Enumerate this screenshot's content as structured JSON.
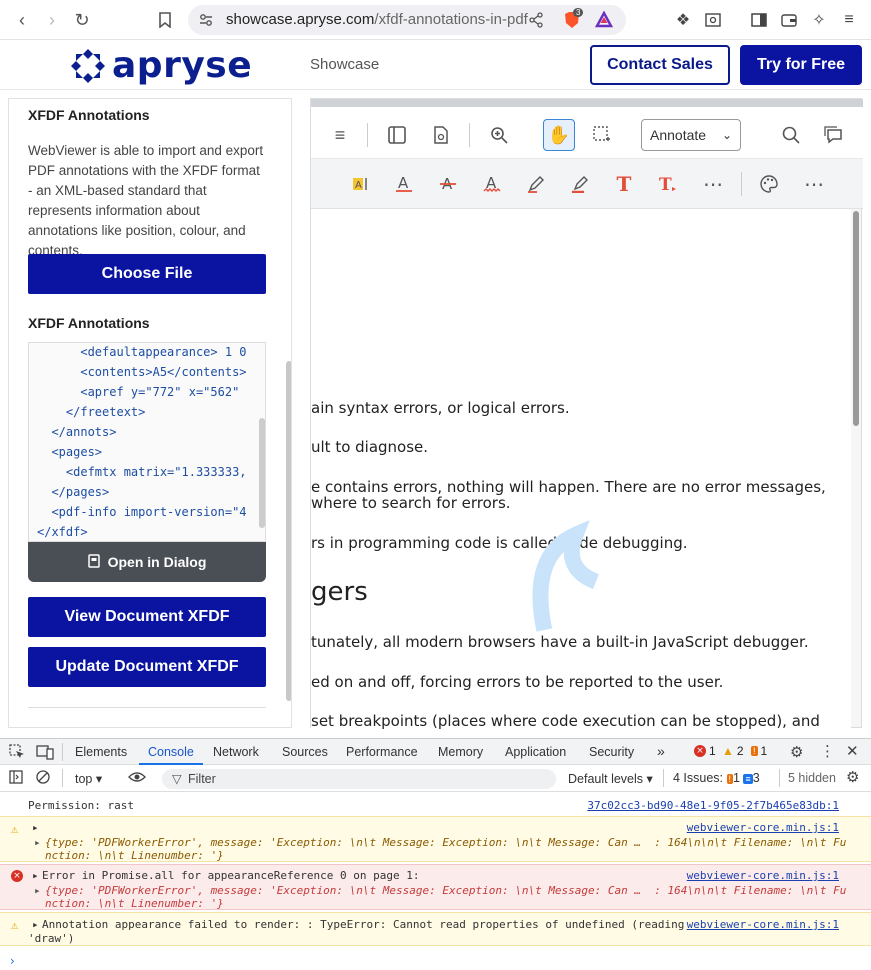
{
  "browser": {
    "url_host": "showcase.apryse.com",
    "url_path": "/xfdf-annotations-in-pdf",
    "brave_badge": "3"
  },
  "site": {
    "logo_text": "apryse",
    "nav_showcase": "Showcase",
    "contact_sales": "Contact Sales",
    "try_free": "Try for Free",
    "brand_color": "#0a14a0"
  },
  "left_panel": {
    "title": "XFDF Annotations",
    "description": "WebViewer is able to import and export PDF annotations with the XFDF format - an XML-based standard that represents information about annotations like position, colour, and contents.",
    "choose_file": "Choose File",
    "annotations_label": "XFDF Annotations",
    "code_lines": [
      "      <defaultappearance> 1 0",
      "      <contents>A5</contents>",
      "      <apref y=\"772\" x=\"562\"",
      "    </freetext>",
      "  </annots>",
      "  <pages>",
      "    <defmtx matrix=\"1.333333,",
      "  </pages>",
      "  <pdf-info import-version=\"4",
      "</xfdf>"
    ],
    "open_dialog": "Open in Dialog",
    "view_xfdf": "View Document XFDF",
    "update_xfdf": "Update Document XFDF"
  },
  "viewer": {
    "annotate_select": "Annotate",
    "page_lines": [
      "ain syntax errors, or logical errors.",
      "ult to diagnose.",
      "e contains errors, nothing will happen. There are no error messages,",
      " where to search for errors.",
      "rs in programming code is called code debugging.",
      "tunately, all modern browsers have a built-in JavaScript debugger.",
      "ed on and off, forcing errors to be reported to the user.",
      "set breakpoints (places where code execution can be stopped), and"
    ],
    "heading": "gers"
  },
  "devtools": {
    "tabs": [
      "Elements",
      "Console",
      "Network",
      "Sources",
      "Performance",
      "Memory",
      "Application",
      "Security"
    ],
    "active_tab": "Console",
    "err_count": "1",
    "warn_count": "2",
    "info_count": "1",
    "context": "top",
    "filter_placeholder": "Filter",
    "levels": "Default levels",
    "issues_label": "4 Issues:",
    "issues_a": "1",
    "issues_b": "3",
    "hidden": "5 hidden"
  },
  "console": {
    "line1_text": "Permission: rast",
    "line1_src": "37c02cc3-bd90-48e1-9f05-2f7b465e83db:1",
    "w1_src": "webviewer-core.min.js:1",
    "w1_l1": "{type: 'PDFWorkerError', message: 'Exception: \\n\\t Message: Exception: \\n\\t Message: Can …  : 164\\n\\n\\t Filename: \\n\\t Fu",
    "w1_l2": "nction: \\n\\t Linenumber: '}",
    "e1_head": "Error in Promise.all for appearanceReference 0 on page 1:",
    "e1_src": "webviewer-core.min.js:1",
    "e1_l1": "{type: 'PDFWorkerError', message: 'Exception: \\n\\t Message: Exception: \\n\\t Message: Can …  : 164\\n\\n\\t Filename: \\n\\t Fu",
    "e1_l2": "nction: \\n\\t Linenumber: '}",
    "w2_head": "Annotation appearance failed to render: : TypeError: Cannot read properties of undefined (reading",
    "w2_src": "webviewer-core.min.js:1",
    "w2_l2": "'draw')"
  }
}
